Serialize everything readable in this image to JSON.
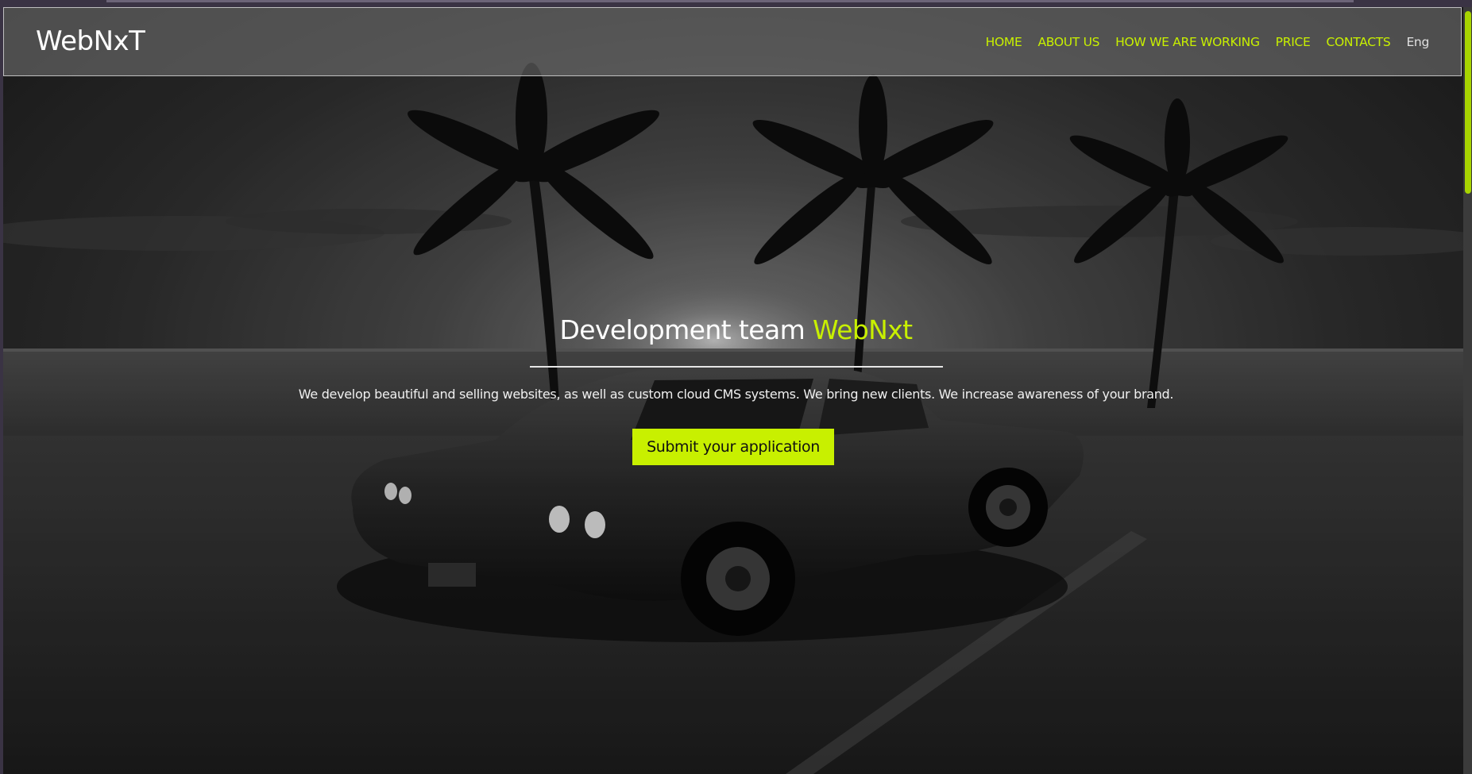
{
  "header": {
    "logo": "WebNxT",
    "nav": {
      "home": "HOME",
      "about": "ABOUT US",
      "working": "HOW WE ARE WORKING",
      "price": "PRICE",
      "contacts": "CONTACTS",
      "lang": "Eng"
    }
  },
  "hero": {
    "title_main": "Development team ",
    "title_accent": "WebNxt",
    "subtitle": "We develop beautiful and selling websites, as well as custom cloud CMS systems. We bring new clients. We increase awareness of your brand.",
    "cta": "Submit your application",
    "background_image": "grayscale beach with palm trees and classic car at dusk"
  },
  "colors": {
    "accent": "#c8f000",
    "text": "#ffffff",
    "header_bg": "#787878"
  }
}
